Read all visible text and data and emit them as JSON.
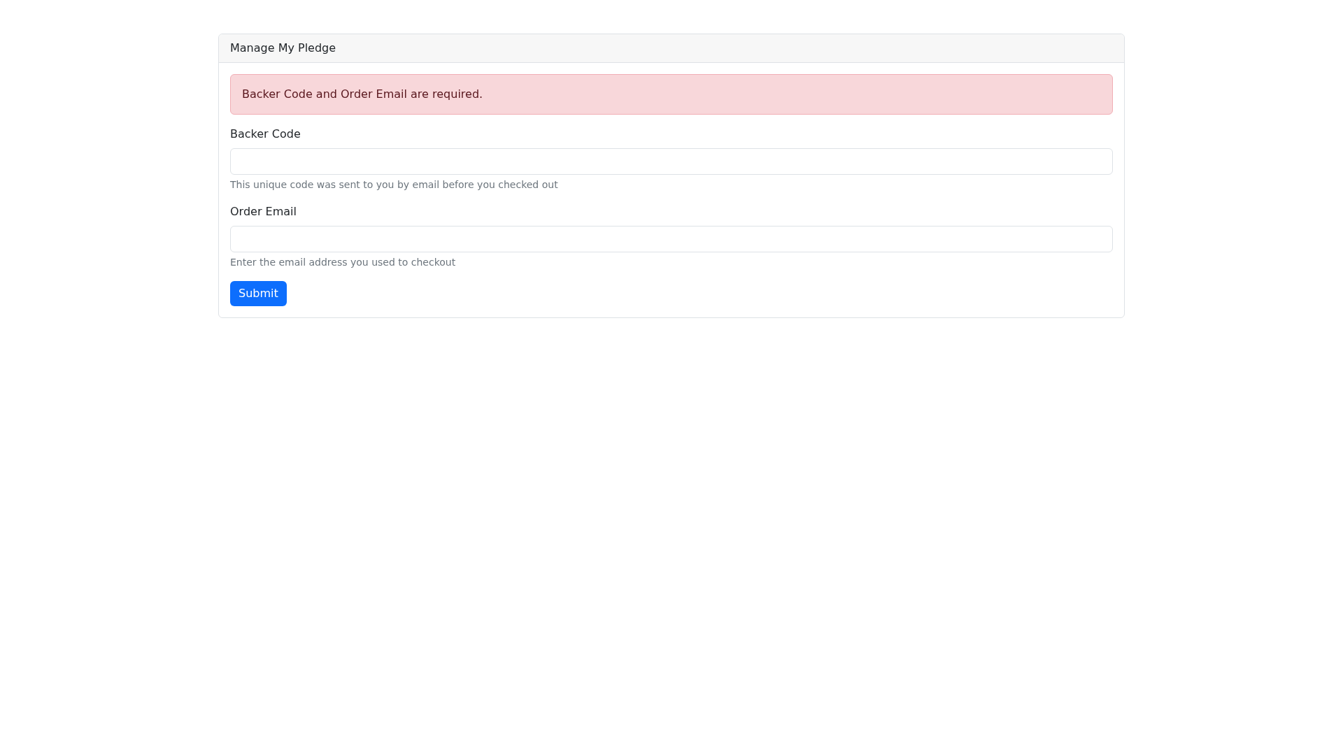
{
  "card": {
    "title": "Manage My Pledge"
  },
  "alert": {
    "text": "Backer Code and Order Email are required."
  },
  "fields": [
    {
      "label": "Backer Code",
      "help": "This unique code was sent to you by email before you checked out"
    },
    {
      "label": "Order Email",
      "help": "Enter the email address you used to checkout"
    }
  ],
  "submit": {
    "label": "Submit"
  }
}
